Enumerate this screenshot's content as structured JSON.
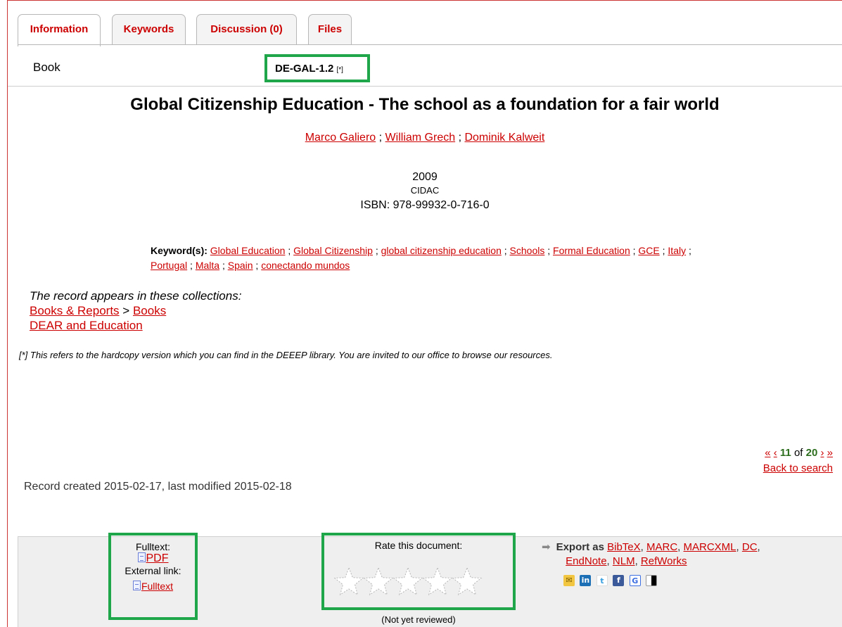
{
  "tabs": [
    "Information",
    "Keywords",
    "Discussion (0)",
    "Files"
  ],
  "record": {
    "type": "Book",
    "call_number": "DE-GAL-1.2",
    "call_mark": "[*]",
    "title": "Global Citizenship Education - The school as a foundation for a fair world",
    "authors": [
      "Marco Galiero",
      "William Grech",
      "Dominik Kalweit"
    ],
    "author_sep": ";",
    "year": "2009",
    "publisher": "CIDAC",
    "isbn": "ISBN: 978-99932-0-716-0"
  },
  "keywords": {
    "label": "Keyword(s):",
    "items": [
      "Global Education",
      "Global Citizenship",
      "global citizenship education",
      "Schools",
      "Formal Education",
      "GCE",
      "Italy",
      "Portugal",
      "Malta",
      "Spain",
      "conectando mundos"
    ]
  },
  "collections": {
    "heading": "The record appears in these collections:",
    "parent": "Books & Reports",
    "separator": ">",
    "child": "Books",
    "other": "DEAR and Education"
  },
  "note": "[*] This refers to the hardcopy version which you can find in the DEEEP library. You are invited to our office to browse our resources.",
  "pager": {
    "first": "«",
    "prev": "‹",
    "current": "11",
    "of": "of",
    "total": "20",
    "next": "›",
    "last": "»",
    "back": "Back to search"
  },
  "created": "Record created 2015-02-17, last modified 2015-02-18",
  "fulltext": {
    "label": "Fulltext:",
    "pdf": "PDF",
    "external_label": "External link:",
    "external": "Fulltext"
  },
  "rating": {
    "heading": "Rate this document:",
    "stars": 5,
    "value": 0,
    "status": "(Not yet reviewed)"
  },
  "export": {
    "label": "Export as",
    "formats": [
      "BibTeX",
      "MARC",
      "MARCXML",
      "DC",
      "EndNote",
      "NLM",
      "RefWorks"
    ]
  },
  "share_icons": [
    "email-icon",
    "linkedin-icon",
    "twitter-icon",
    "facebook-icon",
    "google-icon",
    "delicious-icon"
  ],
  "colors": {
    "link": "#cc0000",
    "highlight": "#1fa64a",
    "page_number": "#2c6e1d"
  }
}
